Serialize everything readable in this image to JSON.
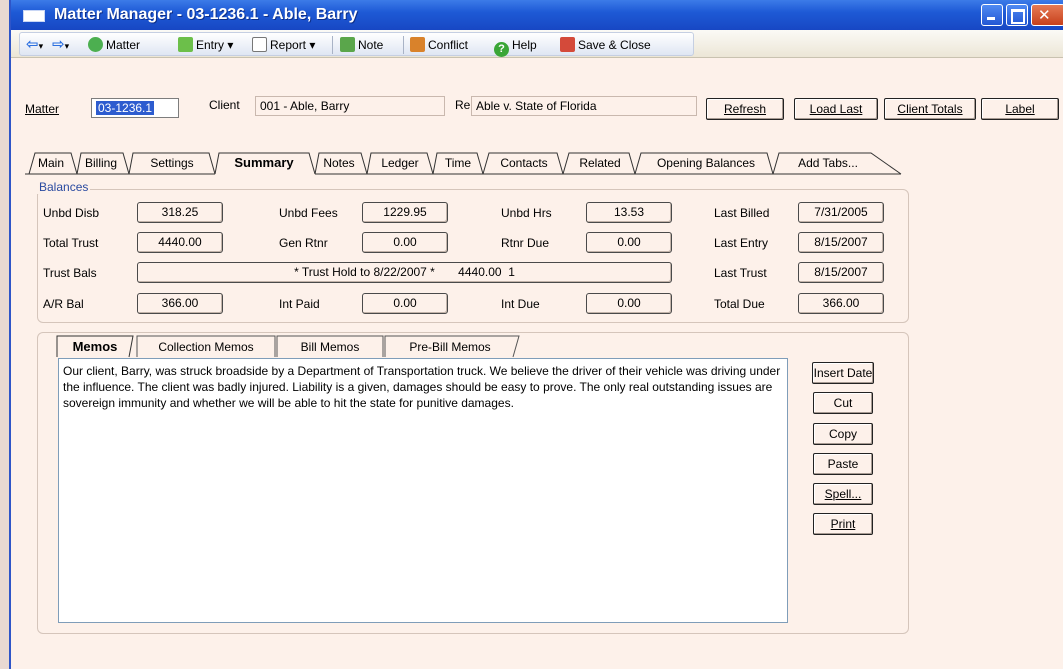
{
  "window": {
    "title": "Matter Manager - 03-1236.1 - Able, Barry"
  },
  "toolbar": {
    "matter": "Matter",
    "entry": "Entry ▾",
    "report": "Report ▾",
    "note": "Note",
    "conflict": "Conflict",
    "help": "Help",
    "save_close": "Save & Close"
  },
  "header": {
    "matter_label": "Matter",
    "matter_value": "03-1236.1",
    "client_label": "Client",
    "client_value": "001 - Able, Barry",
    "re_label": "Re",
    "re_value": "Able v. State of Florida",
    "buttons": {
      "refresh": "Refresh",
      "load_last": "Load Last",
      "client_totals": "Client Totals",
      "label": "Label"
    }
  },
  "tabs": [
    "Main",
    "Billing",
    "Settings",
    "Summary",
    "Notes",
    "Ledger",
    "Time",
    "Contacts",
    "Related",
    "Opening Balances",
    "Add Tabs..."
  ],
  "balances": {
    "title": "Balances",
    "unbd_disb_label": "Unbd Disb",
    "unbd_disb": "318.25",
    "unbd_fees_label": "Unbd Fees",
    "unbd_fees": "1229.95",
    "unbd_hrs_label": "Unbd Hrs",
    "unbd_hrs": "13.53",
    "last_billed_label": "Last Billed",
    "last_billed": "7/31/2005",
    "total_trust_label": "Total Trust",
    "total_trust": "4440.00",
    "gen_rtnr_label": "Gen Rtnr",
    "gen_rtnr": "0.00",
    "rtnr_due_label": "Rtnr Due",
    "rtnr_due": "0.00",
    "last_entry_label": "Last Entry",
    "last_entry": "8/15/2007",
    "trust_bals_label": "Trust Bals",
    "trust_bals": "* Trust Hold to 8/22/2007 *       4440.00  1",
    "last_trust_label": "Last Trust",
    "last_trust": "8/15/2007",
    "ar_bal_label": "A/R Bal",
    "ar_bal": "366.00",
    "int_paid_label": "Int Paid",
    "int_paid": "0.00",
    "int_due_label": "Int Due",
    "int_due": "0.00",
    "total_due_label": "Total Due",
    "total_due": "366.00"
  },
  "memo_tabs": [
    "Memos",
    "Collection Memos",
    "Bill Memos",
    "Pre-Bill Memos"
  ],
  "memo_text": "Our client, Barry, was struck broadside by a Department of Transportation truck. We believe the driver of their vehicle was driving under the influence. The client was badly injured. Liability is a given, damages should be easy to prove. The only real outstanding issues are sovereign immunity and whether we will be able to hit the state for punitive damages.",
  "memo_buttons": {
    "insert_date": "Insert Date",
    "cut": "Cut",
    "copy": "Copy",
    "paste": "Paste",
    "spell": "Spell...",
    "print": "Print"
  }
}
